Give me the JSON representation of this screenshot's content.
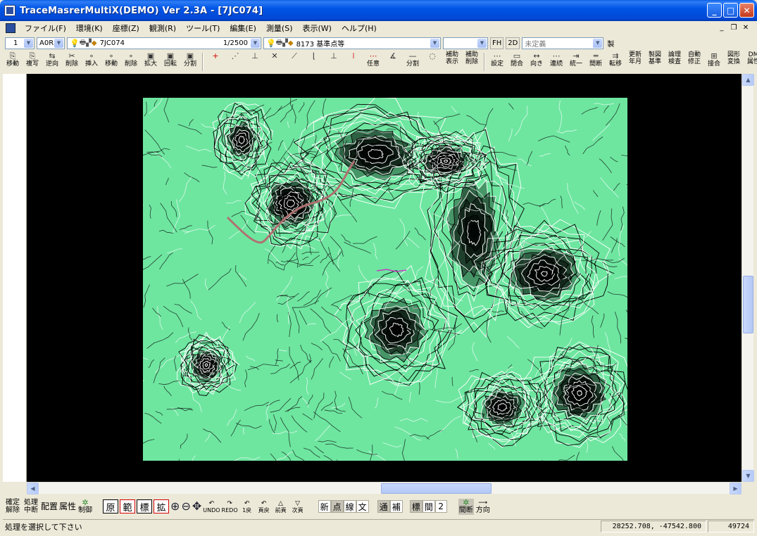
{
  "window": {
    "title": "TraceMasrerMultiX(DEMO) Ver 2.3A - [7JC074]"
  },
  "menu": {
    "items": [
      "ファイル(F)",
      "環境(K)",
      "座標(Z)",
      "観測(R)",
      "ツール(T)",
      "編集(E)",
      "測量(S)",
      "表示(W)",
      "ヘルプ(H)"
    ]
  },
  "toolbar1": {
    "layer_num": "1",
    "layer_code": "A0R",
    "sheet_name": "7JC074",
    "scale": "1/2500",
    "feature_code": "8173 基準点等",
    "blank_combo": "",
    "fh_label": "FH",
    "mode_label": "2D",
    "definition": "未定義",
    "make_label": "製"
  },
  "toolbar2": {
    "group1": [
      {
        "icon": "copy-move-icon",
        "glyph": "⎘",
        "label": "移動"
      },
      {
        "icon": "copy-icon",
        "glyph": "⎘",
        "label": "複写"
      },
      {
        "icon": "reverse-icon",
        "glyph": "⇆",
        "label": "逆向"
      },
      {
        "icon": "cut-delete-icon",
        "glyph": "✂",
        "label": "削除"
      },
      {
        "icon": "insert-point-icon",
        "glyph": "∘",
        "label": "挿入"
      },
      {
        "icon": "move-point-icon",
        "glyph": "∘",
        "label": "移動"
      },
      {
        "icon": "delete-point-icon",
        "glyph": "∘",
        "label": "削除"
      },
      {
        "icon": "enlarge-icon",
        "glyph": "▣",
        "label": "拡大"
      },
      {
        "icon": "rotate-icon",
        "glyph": "▣",
        "label": "回転"
      },
      {
        "icon": "split-icon",
        "glyph": "▣",
        "label": "分割"
      }
    ],
    "group2": [
      {
        "icon": "plus-icon",
        "glyph": "+",
        "label": "",
        "red": true
      },
      {
        "icon": "dx-dy-icon",
        "glyph": "⋰",
        "label": ""
      },
      {
        "icon": "perpendicular-icon",
        "glyph": "⊥",
        "label": ""
      },
      {
        "icon": "cross-icon",
        "glyph": "✕",
        "label": ""
      },
      {
        "icon": "diagonal-line-icon",
        "glyph": "⟋",
        "label": ""
      },
      {
        "icon": "corner-line-icon",
        "glyph": "⌊",
        "label": ""
      },
      {
        "icon": "offset-line-icon",
        "glyph": "⊥",
        "label": ""
      },
      {
        "icon": "dot-grid-icon",
        "glyph": "⁞",
        "label": "",
        "red": true
      },
      {
        "icon": "arbitrary-icon",
        "glyph": "⋯",
        "label": "任意",
        "red": true
      },
      {
        "icon": "rotate-dot-icon",
        "glyph": "∡",
        "label": ""
      },
      {
        "icon": "divide-icon",
        "glyph": "—",
        "label": "分割"
      },
      {
        "icon": "ellipse-icon",
        "glyph": "◌",
        "label": ""
      },
      {
        "icon": "aux-show-icon",
        "glyph": "",
        "label": "補助 表示"
      },
      {
        "icon": "aux-delete-icon",
        "glyph": "",
        "label": "補助 削除"
      }
    ],
    "group3": [
      {
        "icon": "setting-icon",
        "glyph": "⋯",
        "label": "設定"
      },
      {
        "icon": "close-shape-icon",
        "glyph": "▭",
        "label": "閉合"
      },
      {
        "icon": "direction-icon",
        "glyph": "↔",
        "label": "向き"
      },
      {
        "icon": "connect-icon",
        "glyph": "⋯",
        "label": "連続"
      },
      {
        "icon": "unify-icon",
        "glyph": "⇥",
        "label": "統一"
      },
      {
        "icon": "gap-icon",
        "glyph": "═",
        "label": "間断"
      },
      {
        "icon": "transfer-icon",
        "glyph": "⇉",
        "label": "転移"
      },
      {
        "icon": "update-year-icon",
        "glyph": "",
        "label": "更新 年月"
      },
      {
        "icon": "drawing-standard-icon",
        "glyph": "",
        "label": "製図 基準"
      },
      {
        "icon": "logic-check-icon",
        "glyph": "",
        "label": "論理 検査"
      },
      {
        "icon": "auto-fix-icon",
        "glyph": "",
        "label": "自動 修正"
      },
      {
        "icon": "join-icon",
        "glyph": "⊞",
        "label": "接合"
      },
      {
        "icon": "shape-convert-icon",
        "glyph": "",
        "label": "図形 変換"
      },
      {
        "icon": "dm-attribute-icon",
        "glyph": "",
        "label": "DM 属性"
      }
    ]
  },
  "bottombar": {
    "confirm": "確定 解除",
    "process": "処理 中断",
    "place": "配置",
    "attr": "属性",
    "control": "制御",
    "orig": "原",
    "range": "範",
    "std": "標",
    "expand": "拡",
    "undo": "UNDO",
    "redo": "REDO",
    "back1": "1戻",
    "pageback": "頁戻",
    "prevpage": "前頁",
    "nextpage": "次頁",
    "seg_group1": [
      "新",
      "点",
      "線",
      "文"
    ],
    "seg_group2": [
      "通",
      "補"
    ],
    "seg_group3": [
      "標",
      "間",
      "2"
    ],
    "gap_label": "間断",
    "direction_label": "方向"
  },
  "status": {
    "message": "処理を選択して下さい",
    "coords": "28252.708, -47542.800",
    "count": "49724"
  },
  "colors": {
    "map_background": "#6ee6a0",
    "canvas_background": "#000000",
    "titlebar": "#0055e5"
  }
}
